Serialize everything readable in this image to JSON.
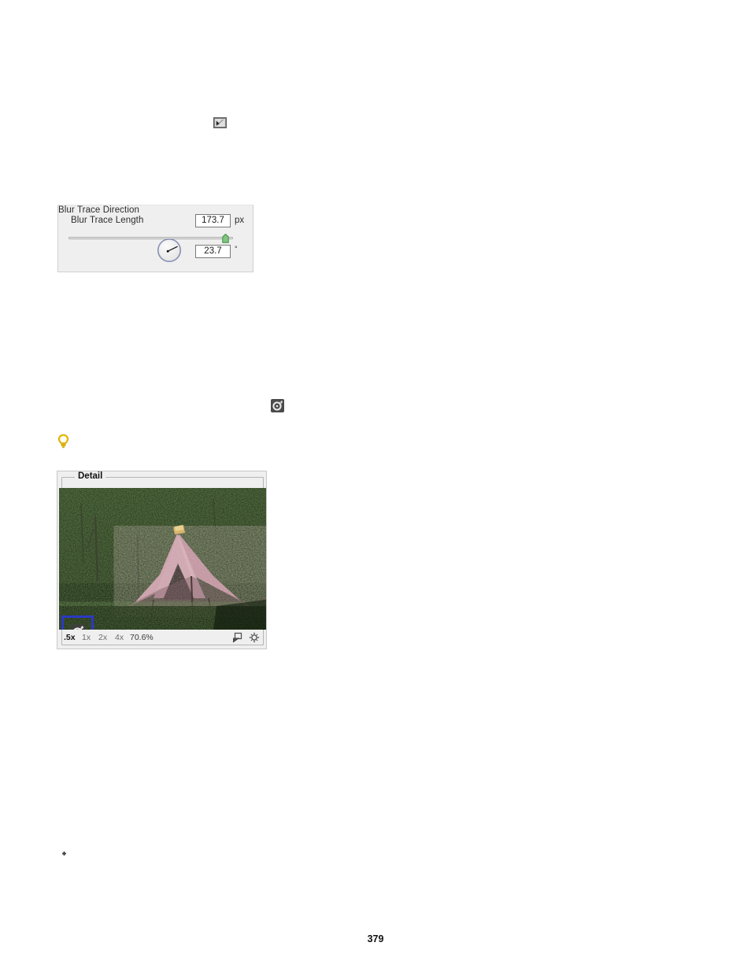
{
  "page": {
    "number": "379"
  },
  "toolbar": {
    "blur_direction_tool_icon": "blur-direction-tool-icon"
  },
  "blur_trace_panel": {
    "length": {
      "label": "Blur Trace Length",
      "value": "173.7",
      "unit": "px",
      "slider_percent": 95
    },
    "direction": {
      "label": "Blur Trace Direction",
      "value": "23.7",
      "unit": "°",
      "dial_angle_deg": 23.7,
      "dial_icon": "angle-dial"
    }
  },
  "inline_icons": {
    "loupe": "loupe-icon",
    "tip_bulb": "lightbulb-tip-icon",
    "bullet": "bullet-marker"
  },
  "detail_panel": {
    "title": "Detail",
    "image_alt": "forest-tent-photo",
    "loupe_overlay_icon": "loupe-icon",
    "loupe_overlay_color": "#2b39c4",
    "zoom_steps": [
      {
        "label": ".5x",
        "active": true
      },
      {
        "label": "1x",
        "active": false
      },
      {
        "label": "2x",
        "active": false
      },
      {
        "label": "4x",
        "active": false
      }
    ],
    "zoom_percent": "70.6%",
    "dock_icon": "undock-detail-icon",
    "refresh_icon": "refresh-detail-icon"
  },
  "colors": {
    "panel_bg": "#efefef",
    "slider_thumb": "#4f9a4f",
    "selection_blue": "#2b39c4",
    "bulb_yellow": "#f2c500"
  }
}
